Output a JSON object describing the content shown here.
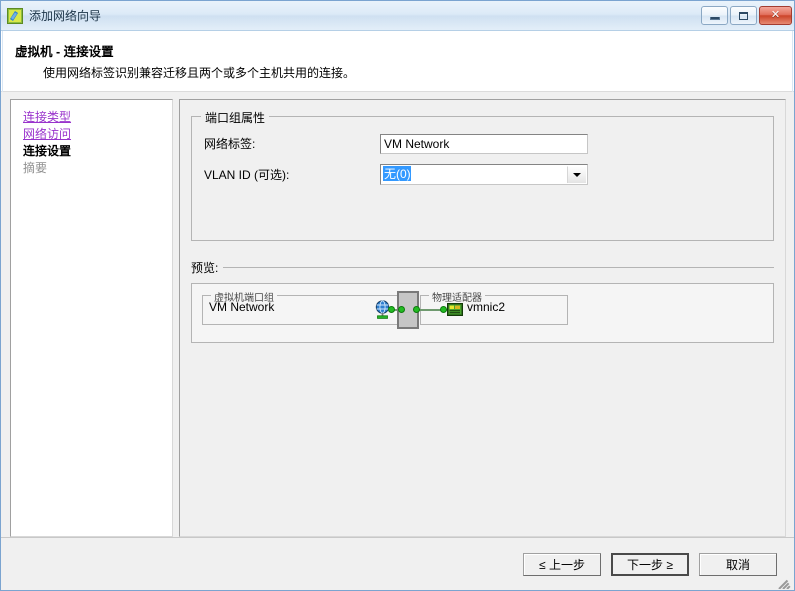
{
  "window": {
    "title": "添加网络向导",
    "icon": "wizard-icon",
    "minimize_label": "最小化",
    "maximize_label": "最大化",
    "close_label": "✕"
  },
  "header": {
    "title": "虚拟机 - 连接设置",
    "subtitle": "使用网络标签识别兼容迁移且两个或多个主机共用的连接。"
  },
  "sidebar": {
    "items": [
      {
        "label": "连接类型",
        "state": "link"
      },
      {
        "label": "网络访问",
        "state": "link"
      },
      {
        "label": "连接设置",
        "state": "current"
      },
      {
        "label": "摘要",
        "state": "disabled"
      }
    ]
  },
  "port_group": {
    "title": "端口组属性",
    "network_label_label": "网络标签:",
    "network_label_value": "VM Network",
    "vlan_label": "VLAN ID (可选):",
    "vlan_value": "无(0)",
    "vlan_dropdown_icon": "chevron-down-icon"
  },
  "preview": {
    "label": "预览:",
    "vm_port_group_title": "虚拟机端口组",
    "vm_port_group_name": "VM Network",
    "vm_port_group_icon": "globe-icon",
    "physical_adapter_title": "物理适配器",
    "physical_adapter_name": "vmnic2",
    "physical_adapter_icon": "network-card-icon",
    "vswitch_icon": "vswitch-icon"
  },
  "footer": {
    "back_label": "≤ 上一步",
    "next_label": "下一步 ≥",
    "cancel_label": "取消"
  },
  "colors": {
    "link": "#9933cc",
    "selection": "#3399ff",
    "connector": "#22bb22",
    "close_button": "#cc4429"
  }
}
